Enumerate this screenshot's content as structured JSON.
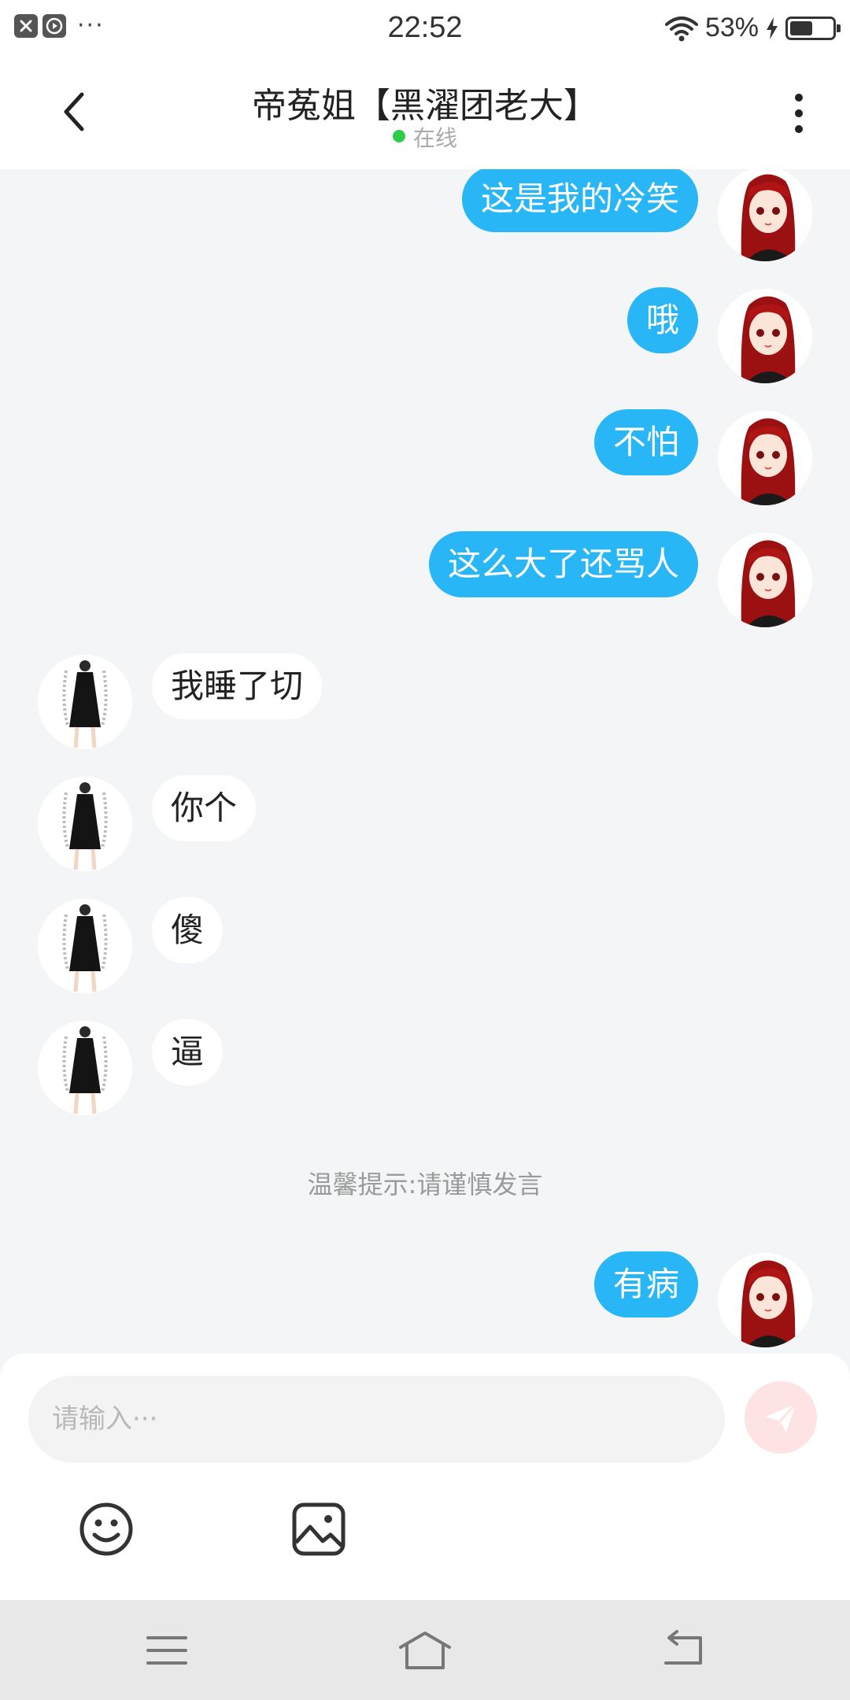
{
  "status_bar": {
    "time": "22:52",
    "battery_percent": "53%",
    "battery_level": 0.53,
    "icons": [
      "close-app-icon",
      "play-app-icon",
      "more-notifications-icon",
      "wifi-icon",
      "charging-icon",
      "battery-icon"
    ]
  },
  "header": {
    "title": "帝菟姐【黑濯团老大】",
    "status": "在线",
    "status_color": "#2fcc4a",
    "back_icon": "chevron-left-icon",
    "menu_icon": "vertical-dots-icon"
  },
  "messages": [
    {
      "dir": "out",
      "text": "这是我的冷笑"
    },
    {
      "dir": "out",
      "text": "哦"
    },
    {
      "dir": "out",
      "text": "不怕"
    },
    {
      "dir": "out",
      "text": "这么大了还骂人"
    },
    {
      "dir": "in",
      "text": "我睡了切"
    },
    {
      "dir": "in",
      "text": "你个"
    },
    {
      "dir": "in",
      "text": "傻"
    },
    {
      "dir": "in",
      "text": "逼"
    },
    {
      "dir": "tip",
      "text": "温馨提示:请谨慎发言"
    },
    {
      "dir": "out",
      "text": "有病"
    }
  ],
  "input": {
    "placeholder": "请输入···",
    "value": ""
  },
  "toolbar": {
    "emoji_icon": "emoji-icon",
    "image_icon": "image-icon",
    "send_icon": "send-icon"
  },
  "navbar": {
    "icons": [
      "menu-icon",
      "home-icon",
      "back-icon"
    ]
  },
  "colors": {
    "outgoing_bubble": "#29b6f6",
    "incoming_bubble": "#ffffff",
    "background": "#f4f5f7",
    "send_button": "#fde3e3"
  }
}
